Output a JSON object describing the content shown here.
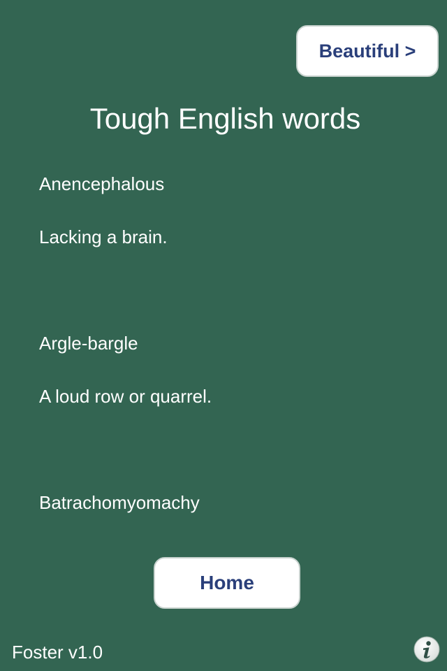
{
  "header": {
    "next_button_label": "Beautiful >"
  },
  "page": {
    "title": "Tough English words"
  },
  "words": [
    {
      "term": "Anencephalous",
      "definition": "Lacking a brain."
    },
    {
      "term": "Argle-bargle",
      "definition": "A loud row or quarrel."
    },
    {
      "term": "Batrachomyomachy",
      "definition": ""
    }
  ],
  "footer": {
    "home_button_label": "Home",
    "version_label": "Foster v1.0",
    "info_icon": "info-icon"
  },
  "colors": {
    "background": "#336552",
    "button_background": "#ffffff",
    "button_text": "#2a3f7a",
    "text": "#ffffff"
  }
}
